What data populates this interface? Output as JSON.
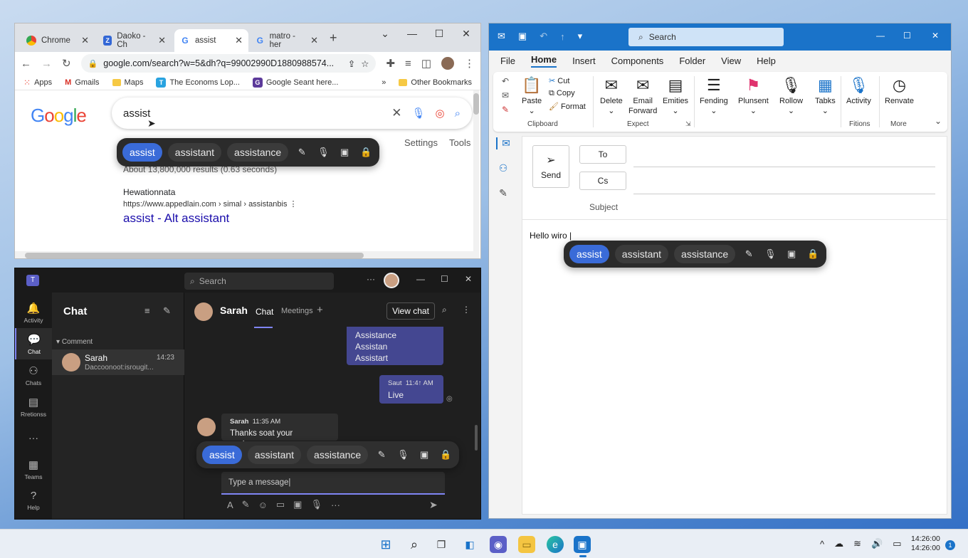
{
  "chrome": {
    "tabs": [
      {
        "label": "Chrome",
        "icon": "chrome-icon"
      },
      {
        "label": "Daoko - Ch",
        "icon": "doc-icon"
      },
      {
        "label": "assist",
        "icon": "google-icon"
      },
      {
        "label": "matro - her",
        "icon": "google-icon"
      }
    ],
    "new_tab": "+",
    "url": "google.com/search?w=5&dh?q=99002990D1880988574...",
    "bookmarks": [
      "Apps",
      "Gmails",
      "Maps",
      "The Economs Lop...",
      "Google Seant here..."
    ],
    "bookmarks_more": "»",
    "other_bookmarks": "Other Bookmarks",
    "google_logo": "Google",
    "query": "assist",
    "settings": "Settings",
    "tools": "Tools",
    "results_count": "About 13,800,000 results (0.63 seconds)",
    "result": {
      "site": "Hewationnata",
      "url": "https://www.appedlain.com › simal › assistanbis",
      "title": "assist - Alt assistant"
    }
  },
  "suggestions": [
    "assist",
    "assistant",
    "assistance"
  ],
  "teams": {
    "search_placeholder": "Search",
    "rail": [
      "Activity",
      "Chat",
      "Chats",
      "Rretionss",
      "Teams",
      "Help"
    ],
    "rail_more": "···",
    "chat_header": "Chat",
    "group": "Comment",
    "conversation": {
      "name": "Sarah",
      "time": "14:23",
      "preview": "Daccoonoot:isrougit..."
    },
    "contact_name": "Sarah",
    "tabs": [
      "Chat",
      "Meetings"
    ],
    "add_tab": "+",
    "view_chat": "View chat",
    "messages_out_1": [
      "Assistance",
      "Assistan",
      "Assistart"
    ],
    "message_out_2": {
      "sender": "Saut",
      "time": "11:4↑ AM",
      "text": "Live"
    },
    "message_in": {
      "sender": "Sarah",
      "time": "11:35 AM",
      "text": "Thanks soat your assistance"
    },
    "compose_placeholder": "Type a message"
  },
  "outlook": {
    "search": "Search",
    "menu": [
      "File",
      "Home",
      "Insert",
      "Components",
      "Folder",
      "View",
      "Help"
    ],
    "active_menu": "Home",
    "clipboard": {
      "paste": "Paste",
      "cut": "Cut",
      "copy": "Copy",
      "format": "Format",
      "group": "Clipboard"
    },
    "expect": {
      "delete": "Delete",
      "email_forward_1": "Email",
      "email_forward_2": "Forward",
      "emities": "Emities",
      "group": "Expect"
    },
    "fending": "Fending",
    "plunsent": "Plunsent",
    "rollow": "Rollow",
    "tabks": "Tabks",
    "activity": "Activity",
    "renvate": "Renvate",
    "fitions": "Fitions",
    "more": "More",
    "send": "Send",
    "to": "To",
    "cc": "Cs",
    "subject": "Subject",
    "body": "Hello wiro"
  },
  "taskbar": {
    "time_1": "14:26:00",
    "time_2": "14:26:00",
    "badge": "1"
  },
  "colors": {
    "accent": "#3a6bd8",
    "outlook_blue": "#1a73c9",
    "teams_purple": "#444791",
    "google_link": "#1a0dab"
  }
}
